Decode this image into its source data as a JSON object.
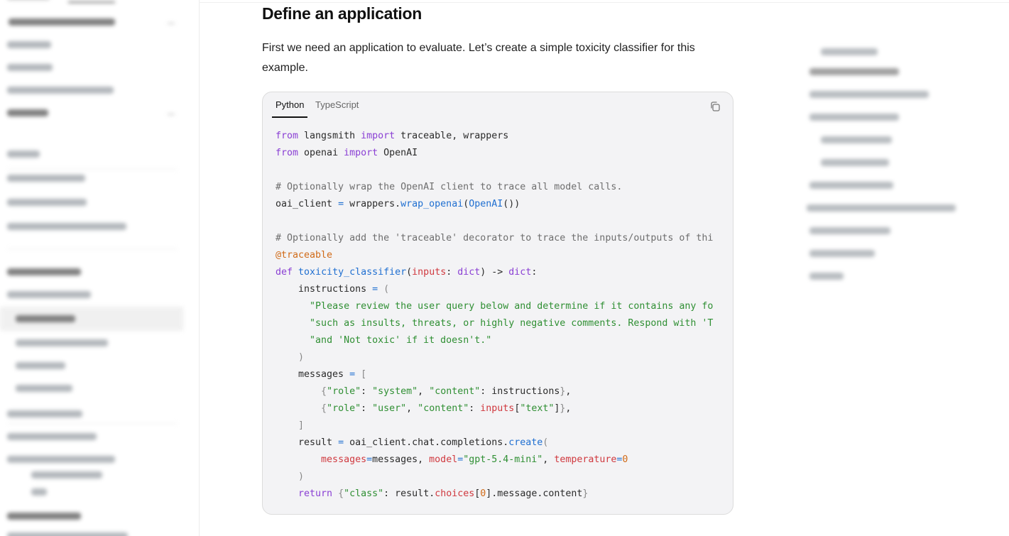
{
  "section": {
    "heading": "Define an application",
    "intro": "First we need an application to evaluate. Let’s create a simple toxicity classifier for this example."
  },
  "code_block": {
    "tabs": [
      {
        "label": "Python",
        "active": true
      },
      {
        "label": "TypeScript",
        "active": false
      }
    ],
    "copy_icon": "copy-icon",
    "language": "python"
  },
  "colors": {
    "keyword": "#8a3fd4",
    "comment": "#6e6e6e",
    "function": "#1f6fd1",
    "string": "#2f8f33",
    "param": "#d0393f",
    "decorator": "#d06a17"
  }
}
